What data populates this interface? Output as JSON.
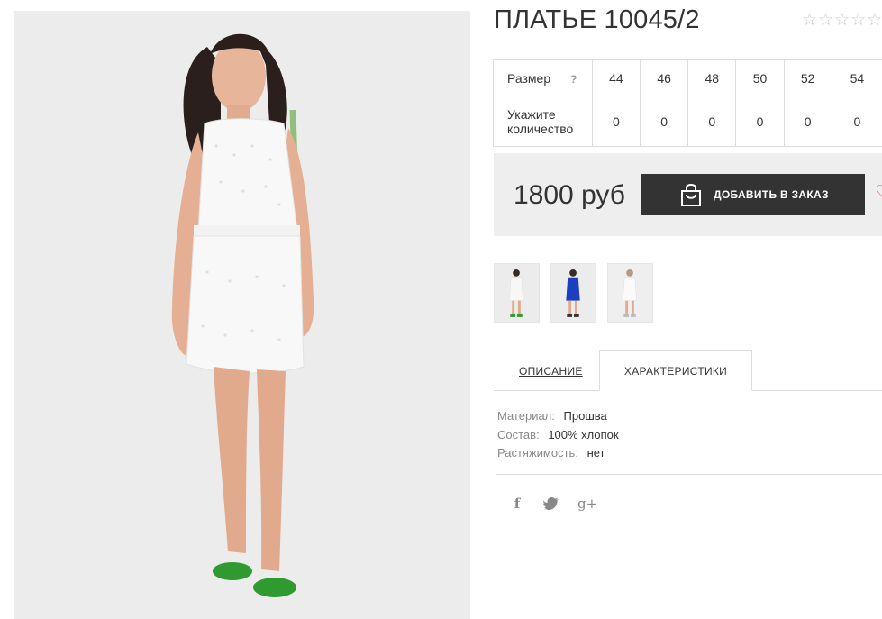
{
  "product": {
    "title": "ПЛАТЬЕ 10045/2",
    "rating_stars": 5,
    "rating_icon": "star-outline-icon"
  },
  "size_table": {
    "size_label": "Размер",
    "help_mark": "?",
    "sizes": [
      "44",
      "46",
      "48",
      "50",
      "52",
      "54"
    ],
    "qty_label_line1": "Укажите",
    "qty_label_line2": "количество",
    "quantities": [
      "0",
      "0",
      "0",
      "0",
      "0",
      "0"
    ]
  },
  "purchase": {
    "price": "1800 руб",
    "add_button_label": "ДОБАВИТЬ В ЗАКАЗ",
    "add_button_icon": "shopping-bag-icon",
    "wishlist_icon": "heart-icon",
    "colors": {
      "button_bg": "#333333",
      "price_box_bg": "#eeeeee",
      "heart": "#e05a6a"
    }
  },
  "thumbnails": [
    {
      "name": "white-dress-thumb",
      "dress_color": "#f4f4f4"
    },
    {
      "name": "blue-dress-thumb",
      "dress_color": "#1c3fbf"
    },
    {
      "name": "white-dress-thumb-2",
      "dress_color": "#f7f7f7"
    }
  ],
  "tabs": {
    "description": "ОПИСАНИЕ",
    "characteristics": "ХАРАКТЕРИСТИКИ",
    "active": "characteristics"
  },
  "specs": [
    {
      "key": "Материал:",
      "value": "Прошва"
    },
    {
      "key": "Состав:",
      "value": "100% хлопок"
    },
    {
      "key": "Растяжимость:",
      "value": "нет"
    }
  ],
  "social": [
    {
      "name": "facebook-icon",
      "glyph": "f"
    },
    {
      "name": "twitter-icon",
      "glyph": "🐦"
    },
    {
      "name": "google-plus-icon",
      "glyph": "g+"
    }
  ]
}
